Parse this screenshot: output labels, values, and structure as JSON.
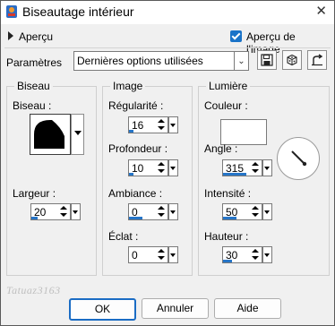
{
  "titlebar": {
    "title": "Biseautage intérieur",
    "close_glyph": "✕"
  },
  "preview": {
    "toggle_label": "Aperçu",
    "checkbox_label": "Aperçu de l'image",
    "checked": true
  },
  "params": {
    "label": "Paramètres",
    "preset_value": "Dernières options utilisées"
  },
  "groups": {
    "bevel": {
      "title": "Biseau",
      "bevel_label": "Biseau :",
      "width_label": "Largeur :",
      "width_value": "20"
    },
    "image": {
      "title": "Image",
      "smoothness_label": "Régularité :",
      "smoothness_value": "16",
      "depth_label": "Profondeur :",
      "depth_value": "10",
      "ambience_label": "Ambiance :",
      "ambience_value": "0",
      "shininess_label": "Éclat :",
      "shininess_value": "0"
    },
    "light": {
      "title": "Lumière",
      "color_label": "Couleur :",
      "color_value": "#ffffff",
      "angle_label": "Angle :",
      "angle_value": "315",
      "intensity_label": "Intensité :",
      "intensity_value": "50",
      "elevation_label": "Hauteur :",
      "elevation_value": "30"
    }
  },
  "buttons": {
    "ok": "OK",
    "cancel": "Annuler",
    "help": "Aide"
  },
  "watermark": "Tatuaz3163",
  "colors": {
    "accent": "#1a6cc4",
    "bar": "#2675c8"
  }
}
